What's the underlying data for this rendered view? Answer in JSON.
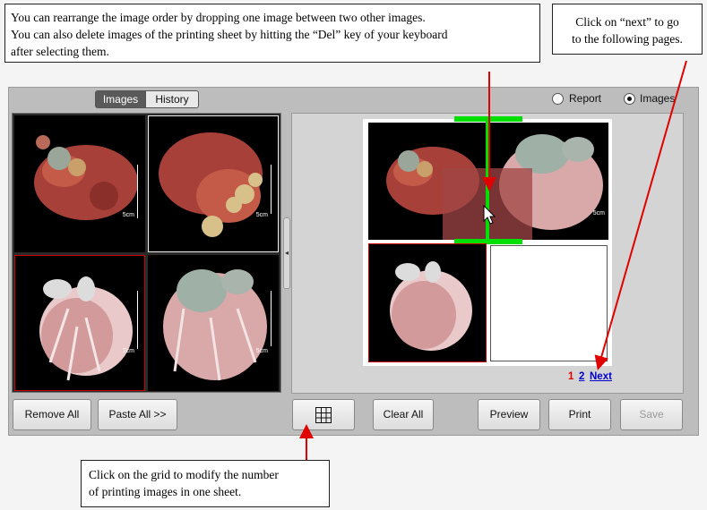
{
  "callouts": {
    "rearrange": [
      "You can rearrange the image order by dropping one image between two other images.",
      "You can also delete images of the printing sheet by hitting the “Del” key of your keyboard",
      "after selecting them."
    ],
    "next": [
      "Click on “next” to go",
      "to the following pages."
    ],
    "grid": [
      "Click on the grid to modify the number",
      "of printing images in one sheet."
    ]
  },
  "tabs": {
    "images": "Images",
    "history": "History"
  },
  "radios": {
    "report": "Report",
    "images": "Images",
    "selected": "images"
  },
  "thumbs": {
    "scale_label": "5cm",
    "scale_label_alt": "7cm"
  },
  "buttons": {
    "remove_all": "Remove All",
    "paste_all": "Paste All >>",
    "clear_all": "Clear All",
    "preview": "Preview",
    "print": "Print",
    "save": "Save"
  },
  "pager": {
    "current": "1",
    "page2": "2",
    "next": "Next"
  },
  "splitter_glyph": "◂",
  "colors": {
    "accent_red": "#e00000",
    "drop_green": "#00e000",
    "pager_blue": "#0000cc"
  }
}
